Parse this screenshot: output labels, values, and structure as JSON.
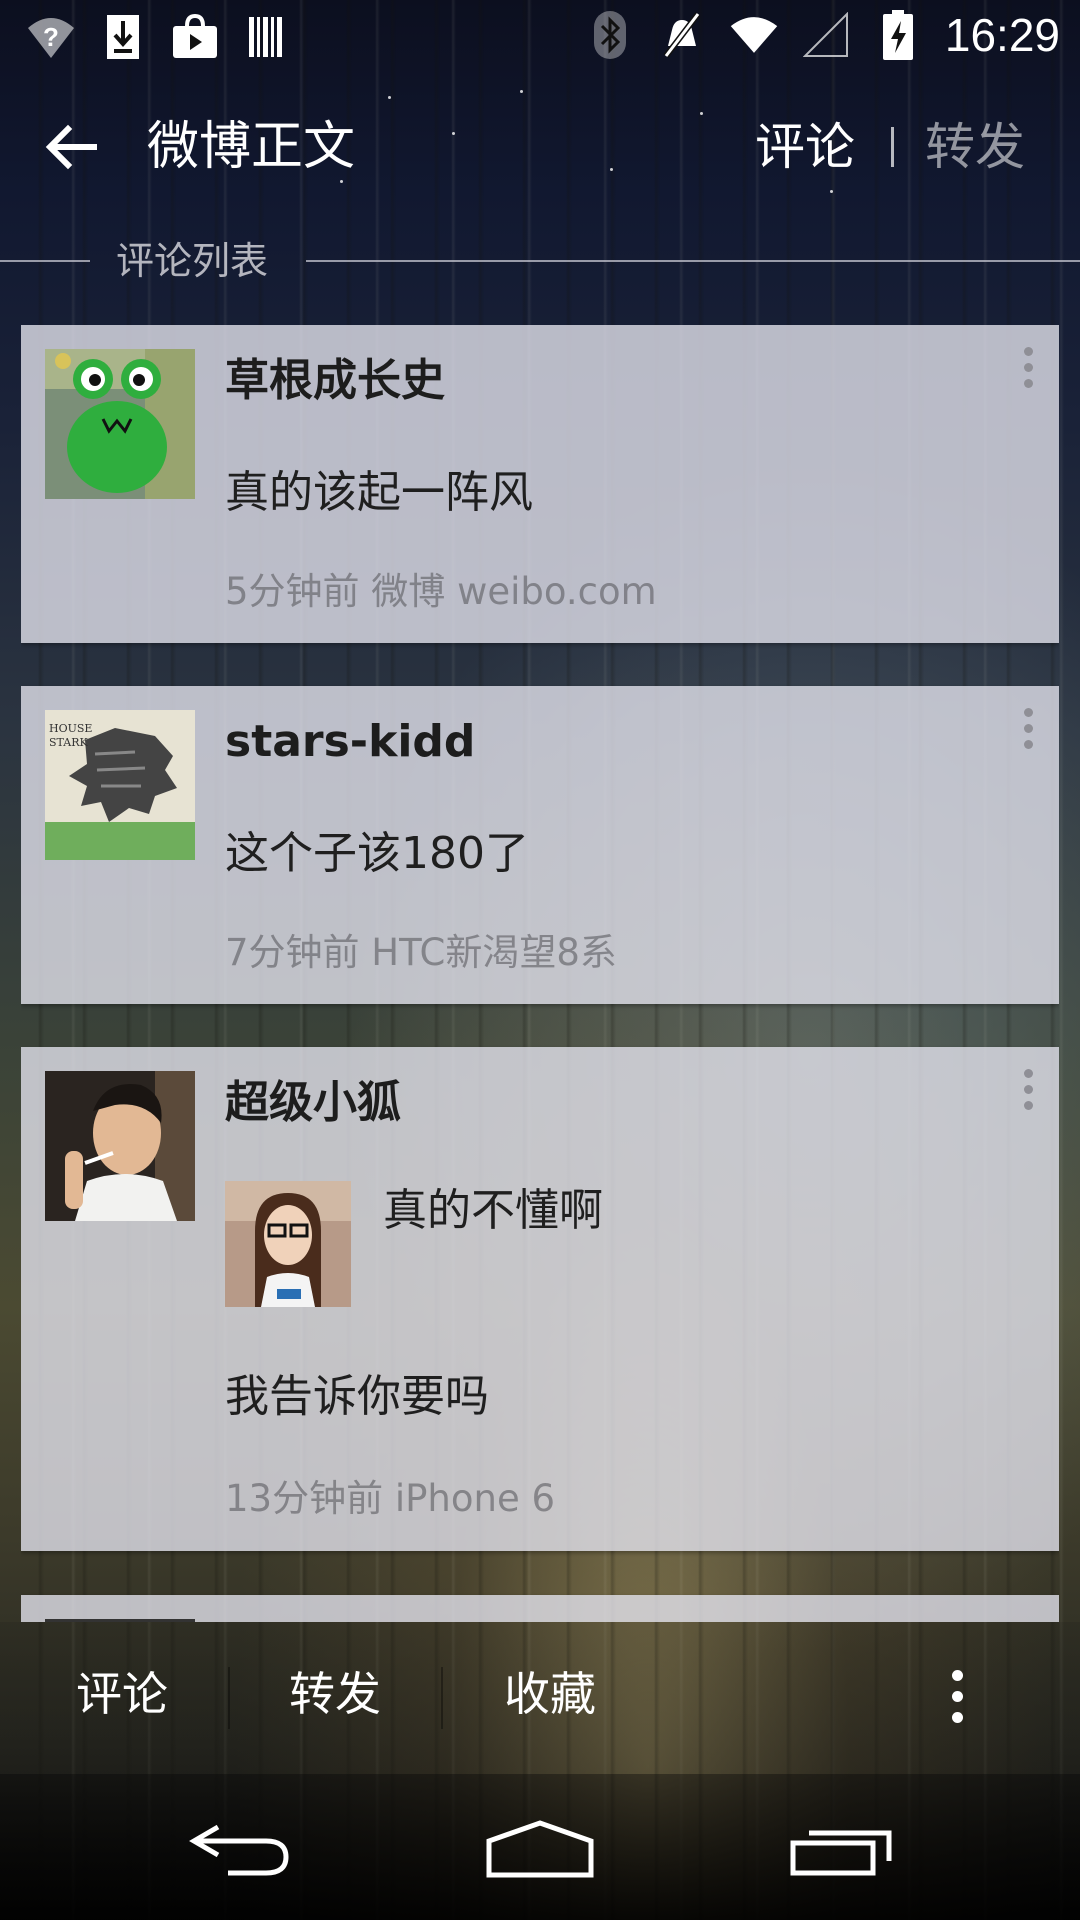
{
  "status_bar": {
    "time": "16:29",
    "left_icons": [
      "wifi-question-icon",
      "download-icon",
      "play-store-icon",
      "barcode-icon"
    ],
    "right_icons": [
      "bluetooth-icon",
      "mute-icon",
      "wifi-icon",
      "signal-icon",
      "battery-charging-icon"
    ]
  },
  "action_bar": {
    "title": "微博正文",
    "tab_comment": "评论",
    "tab_repost": "转发"
  },
  "section": {
    "title": "评论列表"
  },
  "comments": [
    {
      "name": "草根成长史",
      "text": "真的该起一阵风",
      "meta": "5分钟前 微博 weibo.com",
      "avatar": "frog-avatar"
    },
    {
      "name": "stars-kidd",
      "text": "这个子该180了",
      "meta": "7分钟前 HTC新渴望8系",
      "avatar": "house-stark-avatar",
      "avatar_text": [
        "HOUSE",
        "STARK"
      ]
    },
    {
      "name": "超级小狐",
      "quote_text": "真的不懂啊",
      "text": "我告诉你要吗",
      "meta": "13分钟前 iPhone 6",
      "avatar": "man-avatar",
      "quote_image": "girl-photo"
    }
  ],
  "bottom_bar": {
    "comment": "评论",
    "repost": "转发",
    "favorite": "收藏"
  },
  "colors": {
    "card_bg": "#e2e2ec",
    "meta_text": "#8a8a8f",
    "name_text": "#1d1d1d"
  }
}
